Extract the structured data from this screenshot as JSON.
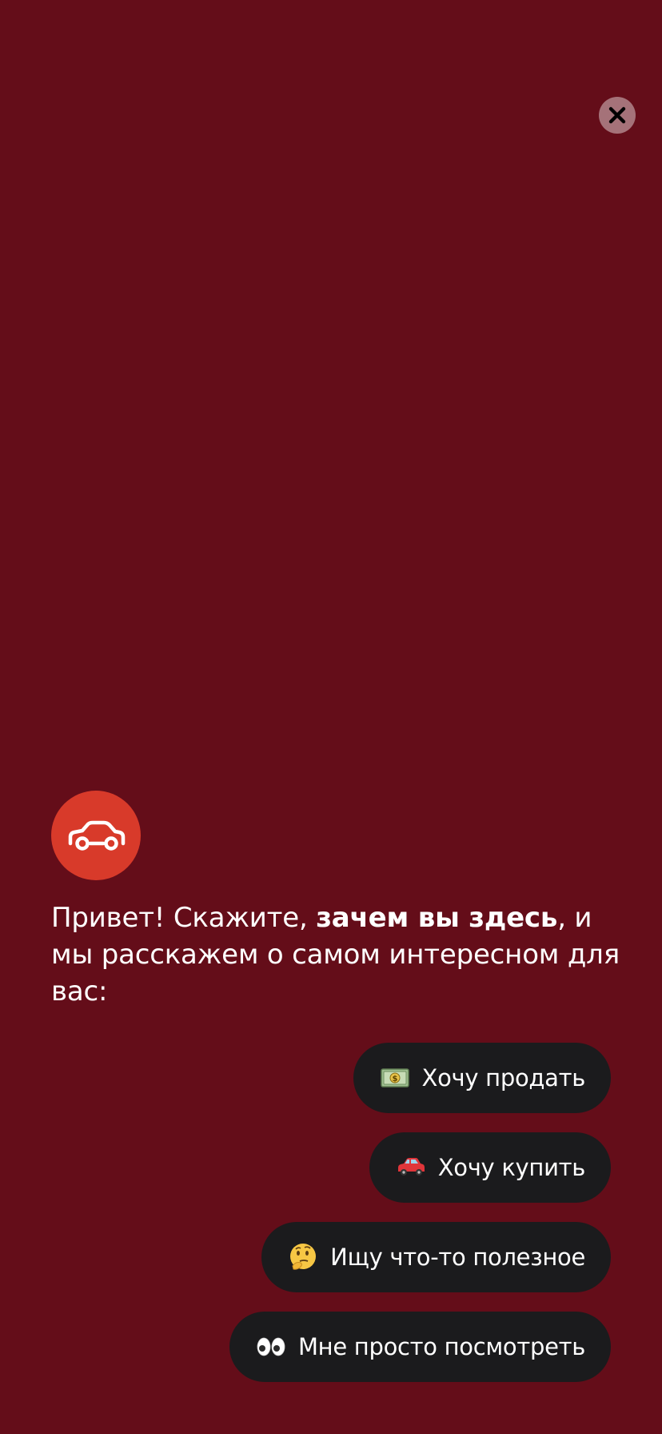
{
  "colors": {
    "background": "#640d19",
    "accent": "#d83a2a",
    "button_bg": "#1b1b1d",
    "close_bg": "rgba(255,255,255,0.42)"
  },
  "close": {
    "icon": "close-icon"
  },
  "logo": {
    "icon": "car-icon"
  },
  "greeting": {
    "part1": "Привет! Скажите, ",
    "bold": "зачем вы здесь",
    "part2": ", и мы расскажем о самом интересном для вас:"
  },
  "options": [
    {
      "icon": "money-icon",
      "label": "Хочу продать"
    },
    {
      "icon": "red-car-icon",
      "label": "Хочу купить"
    },
    {
      "icon": "thinking-face-icon",
      "label": "Ищу что-то полезное"
    },
    {
      "icon": "eyes-icon",
      "label": "Мне просто посмотреть"
    }
  ]
}
